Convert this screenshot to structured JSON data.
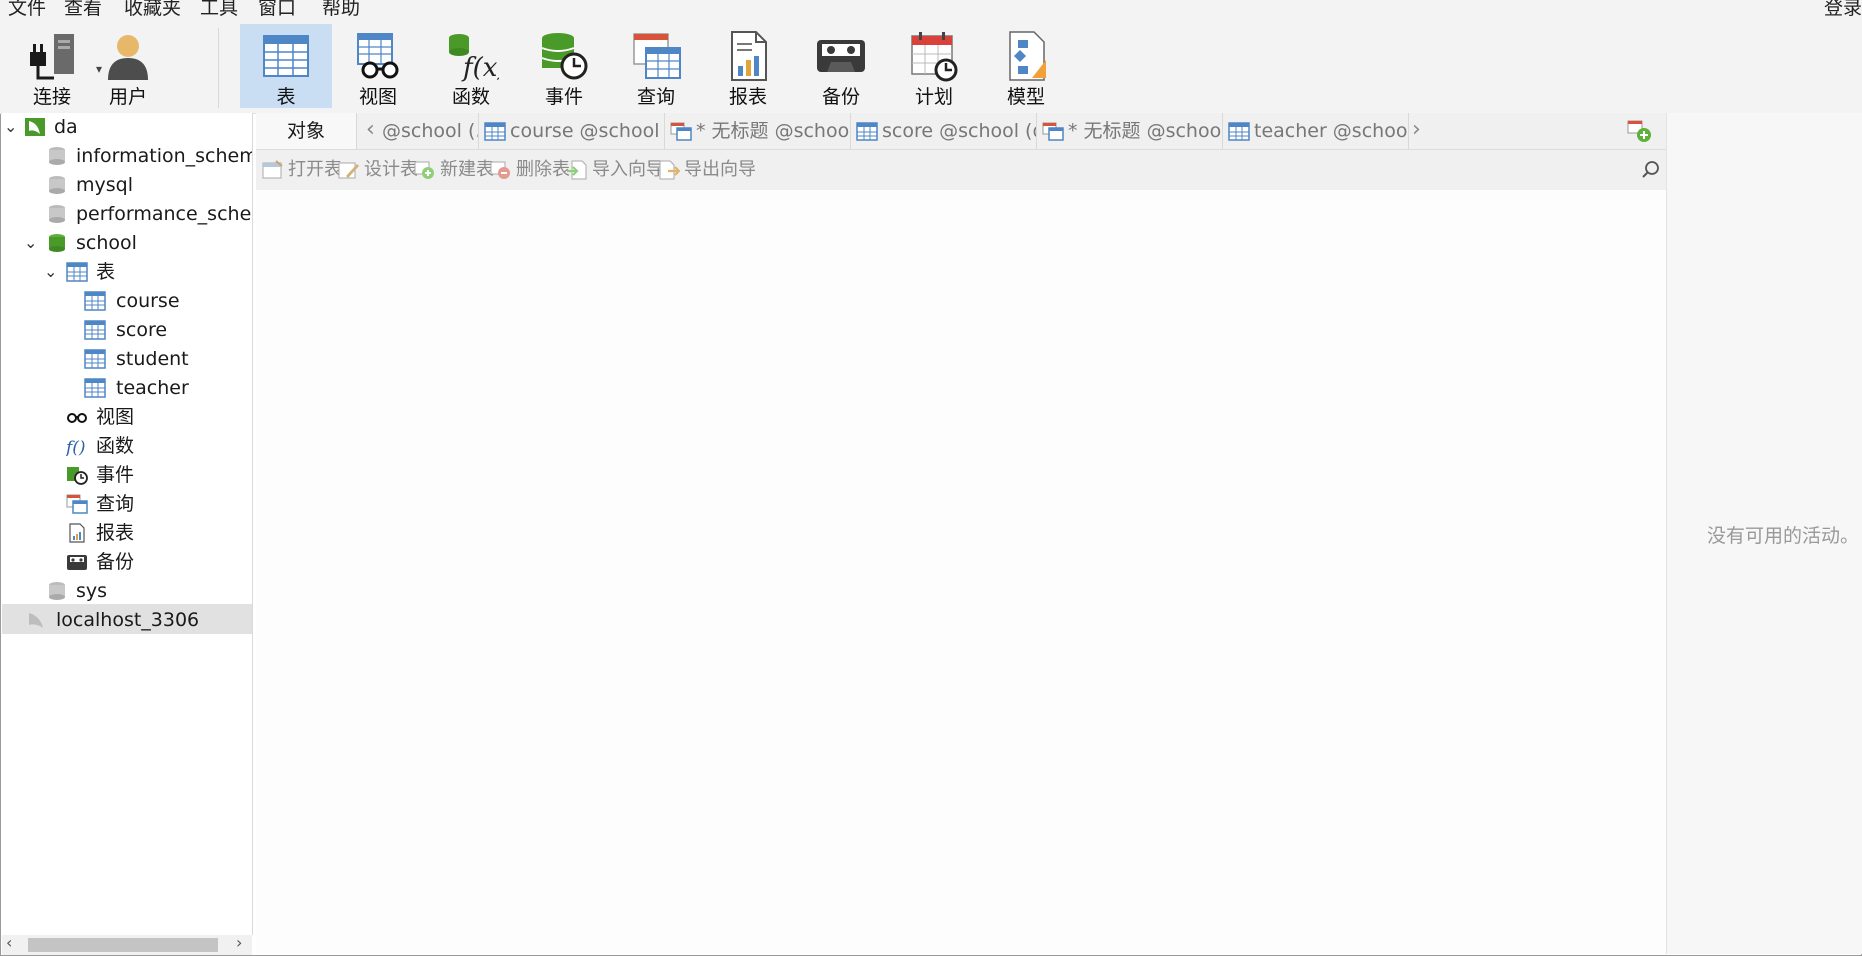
{
  "menu": [
    "文件",
    "查看",
    "收藏夹",
    "工具",
    "窗口",
    "帮助"
  ],
  "login": "登录",
  "toolbar": [
    {
      "label": "连接",
      "icon": "connection-plug-icon"
    },
    {
      "label": "用户",
      "icon": "user-icon"
    },
    {
      "label": "表",
      "icon": "table-icon",
      "active": true
    },
    {
      "label": "视图",
      "icon": "view-glasses-icon"
    },
    {
      "label": "函数",
      "icon": "function-icon"
    },
    {
      "label": "事件",
      "icon": "event-clock-icon"
    },
    {
      "label": "查询",
      "icon": "query-icon"
    },
    {
      "label": "报表",
      "icon": "report-icon"
    },
    {
      "label": "备份",
      "icon": "backup-icon"
    },
    {
      "label": "计划",
      "icon": "schedule-calendar-icon"
    },
    {
      "label": "模型",
      "icon": "model-icon"
    }
  ],
  "tree": {
    "connection": "da",
    "databases": [
      "information_schema",
      "mysql",
      "performance_schema",
      "school",
      "sys"
    ],
    "school_folders": {
      "tables": "表",
      "views": "视图",
      "functions": "函数",
      "events": "事件",
      "queries": "查询",
      "reports": "报表",
      "backups": "备份"
    },
    "tables": [
      "course",
      "score",
      "student",
      "teacher"
    ],
    "other_connection": "localhost_3306"
  },
  "tabs": {
    "objects": "对象",
    "items": [
      {
        "label": "@school (...",
        "icon": "none"
      },
      {
        "label": "course @school (da...",
        "icon": "table-icon"
      },
      {
        "label": "* 无标题 @school (...",
        "icon": "query-icon"
      },
      {
        "label": "score @school (da) ...",
        "icon": "table-icon"
      },
      {
        "label": "* 无标题 @school (...",
        "icon": "query-icon"
      },
      {
        "label": "teacher @school (d...",
        "icon": "table-icon"
      }
    ]
  },
  "object_toolbar": {
    "open": "打开表",
    "design": "设计表",
    "new": "新建表",
    "delete": "删除表",
    "import": "导入向导",
    "export": "导出向导"
  },
  "right_pane": {
    "message": "没有可用的活动。"
  },
  "colors": {
    "active_tool": "#c9def3",
    "db_green": "#4a9a2a",
    "table_blue": "#4f86c6"
  }
}
